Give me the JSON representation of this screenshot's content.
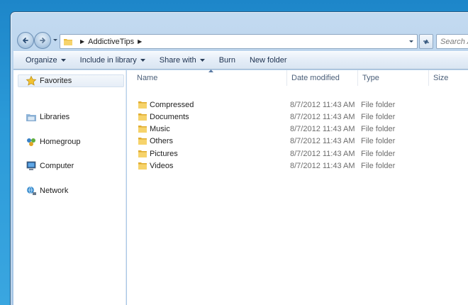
{
  "address": {
    "crumb": "AddictiveTips",
    "search_placeholder": "Search Addictiv"
  },
  "toolbar": {
    "organize": "Organize",
    "include_in_library": "Include in library",
    "share_with": "Share with",
    "burn": "Burn",
    "new_folder": "New folder"
  },
  "nav": {
    "favorites": "Favorites",
    "libraries": "Libraries",
    "homegroup": "Homegroup",
    "computer": "Computer",
    "network": "Network"
  },
  "columns": {
    "name": "Name",
    "date_modified": "Date modified",
    "type": "Type",
    "size": "Size"
  },
  "files": [
    {
      "name": "Compressed",
      "date": "8/7/2012 11:43 AM",
      "type": "File folder"
    },
    {
      "name": "Documents",
      "date": "8/7/2012 11:43 AM",
      "type": "File folder"
    },
    {
      "name": "Music",
      "date": "8/7/2012 11:43 AM",
      "type": "File folder"
    },
    {
      "name": "Others",
      "date": "8/7/2012 11:43 AM",
      "type": "File folder"
    },
    {
      "name": "Pictures",
      "date": "8/7/2012 11:43 AM",
      "type": "File folder"
    },
    {
      "name": "Videos",
      "date": "8/7/2012 11:43 AM",
      "type": "File folder"
    }
  ],
  "icons": {
    "back": "back-arrow-icon",
    "forward": "forward-arrow-icon",
    "folder": "folder-icon",
    "refresh": "refresh-icon",
    "favorites": "star-icon",
    "libraries": "library-icon",
    "homegroup": "homegroup-icon",
    "computer": "computer-icon",
    "network": "network-icon"
  },
  "colors": {
    "desktop": "#2b9ad8",
    "window_chrome": "#aecbe9",
    "folder_yellow": "#f3c84f"
  }
}
